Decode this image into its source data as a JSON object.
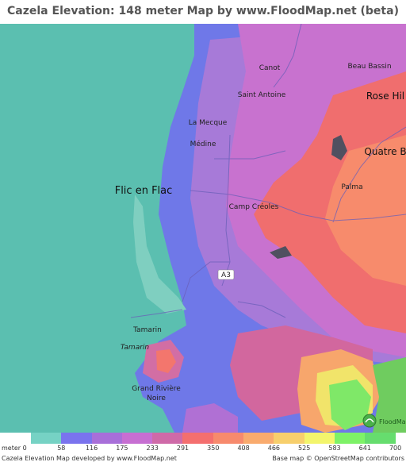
{
  "title": "Cazela Elevation: 148 meter Map by www.FloodMap.net (beta)",
  "places": {
    "canot": "Canot",
    "beau_bassin": "Beau Bassin",
    "saint_antoine": "Saint Antoine",
    "rose_hill": "Rose Hil",
    "la_mecque": "La Mecque",
    "medine": "Médine",
    "quatre_bornes": "Quatre B",
    "flic_en_flac": "Flic en Flac",
    "palma": "Palma",
    "camp_creoles": "Camp Créoles",
    "a3": "A3",
    "tamarin": "Tamarin",
    "tamarin_river": "Tamarin",
    "grand_riviere_1": "Grand Rivière",
    "grand_riviere_2": "Noire"
  },
  "legend": {
    "unit": "meter 0",
    "ticks": [
      "58",
      "116",
      "175",
      "233",
      "291",
      "350",
      "408",
      "466",
      "525",
      "583",
      "641",
      "700"
    ],
    "colors": [
      "#76d2c4",
      "#7a73ee",
      "#a86fd9",
      "#c76fd2",
      "#cf6aa8",
      "#f46f6f",
      "#f78a6d",
      "#f9ab6e",
      "#f7cf6c",
      "#f3f56c",
      "#7ef267",
      "#66dd6e"
    ]
  },
  "footer": {
    "left": "Cazela Elevation Map developed by www.FloodMap.net",
    "right": "Base map © OpenStreetMap contributors"
  }
}
